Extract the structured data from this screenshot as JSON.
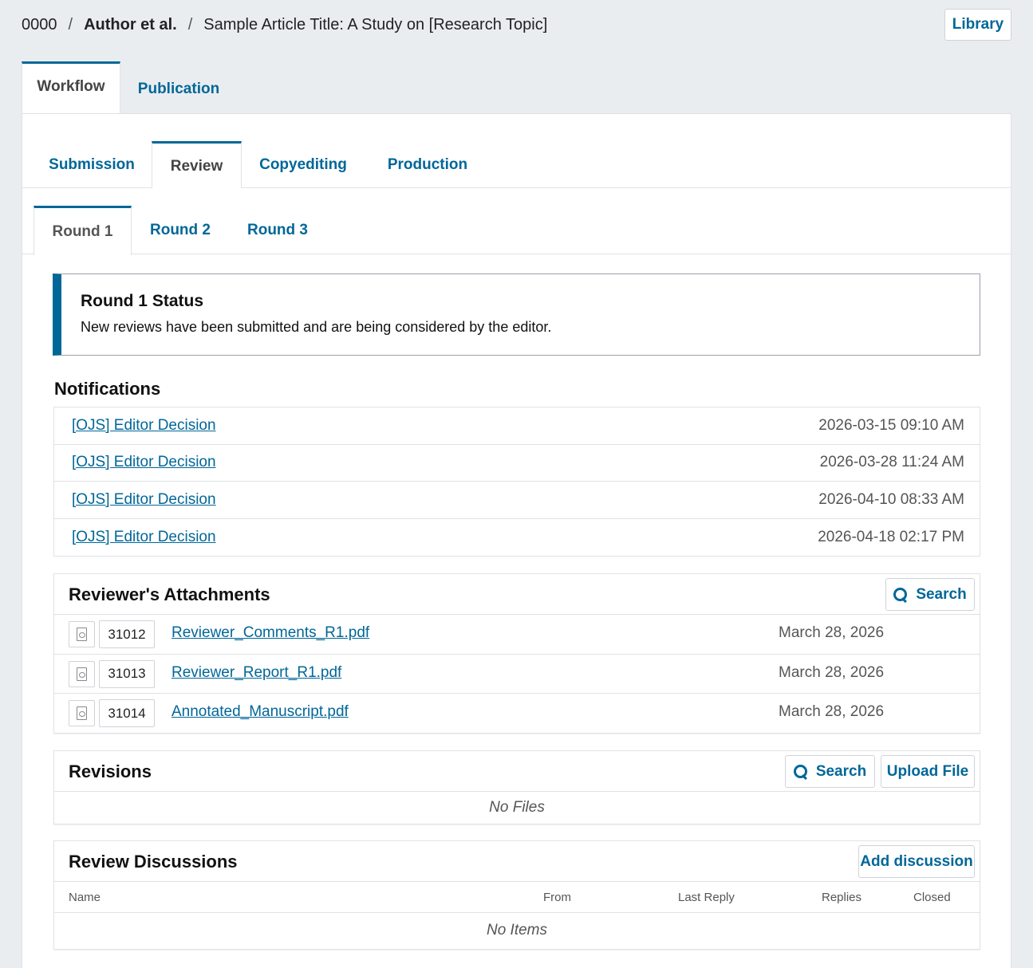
{
  "breadcrumb": {
    "id": "0000",
    "sep": "/",
    "author": "Author et al.",
    "title": "Sample Article Title: A Study on [Research Topic]"
  },
  "library_label": "Library",
  "top_tabs": [
    {
      "label": "Workflow",
      "active": true
    },
    {
      "label": "Publication",
      "active": false
    }
  ],
  "stage_tabs": [
    {
      "label": "Submission",
      "active": false
    },
    {
      "label": "Review",
      "active": true
    },
    {
      "label": "Copyediting",
      "active": false
    },
    {
      "label": "Production",
      "active": false
    }
  ],
  "round_tabs": [
    {
      "label": "Round 1",
      "active": true
    },
    {
      "label": "Round 2",
      "active": false
    },
    {
      "label": "Round 3",
      "active": false
    }
  ],
  "status": {
    "title": "Round 1 Status",
    "text": "New reviews have been submitted and are being considered by the editor."
  },
  "notifications": {
    "title": "Notifications",
    "items": [
      {
        "label": "[OJS] Editor Decision",
        "date": "2026-03-15 09:10 AM"
      },
      {
        "label": "[OJS] Editor Decision",
        "date": "2026-03-28 11:24 AM"
      },
      {
        "label": "[OJS] Editor Decision",
        "date": "2026-04-10 08:33 AM"
      },
      {
        "label": "[OJS] Editor Decision",
        "date": "2026-04-18 02:17 PM"
      }
    ]
  },
  "attachments": {
    "title": "Reviewer's Attachments",
    "search_label": "Search",
    "files": [
      {
        "id": "31012",
        "name": "Reviewer_Comments_R1.pdf",
        "date": "March 28, 2026"
      },
      {
        "id": "31013",
        "name": "Reviewer_Report_R1.pdf",
        "date": "March 28, 2026"
      },
      {
        "id": "31014",
        "name": "Annotated_Manuscript.pdf",
        "date": "March 28, 2026"
      }
    ]
  },
  "revisions": {
    "title": "Revisions",
    "search_label": "Search",
    "upload_label": "Upload File",
    "empty": "No Files"
  },
  "discussions": {
    "title": "Review Discussions",
    "add_label": "Add discussion",
    "columns": {
      "name": "Name",
      "from": "From",
      "last_reply": "Last Reply",
      "replies": "Replies",
      "closed": "Closed"
    },
    "empty": "No Items"
  },
  "colors": {
    "accent": "#006798",
    "background": "#eaedf0",
    "border": "#dfe2e5"
  }
}
